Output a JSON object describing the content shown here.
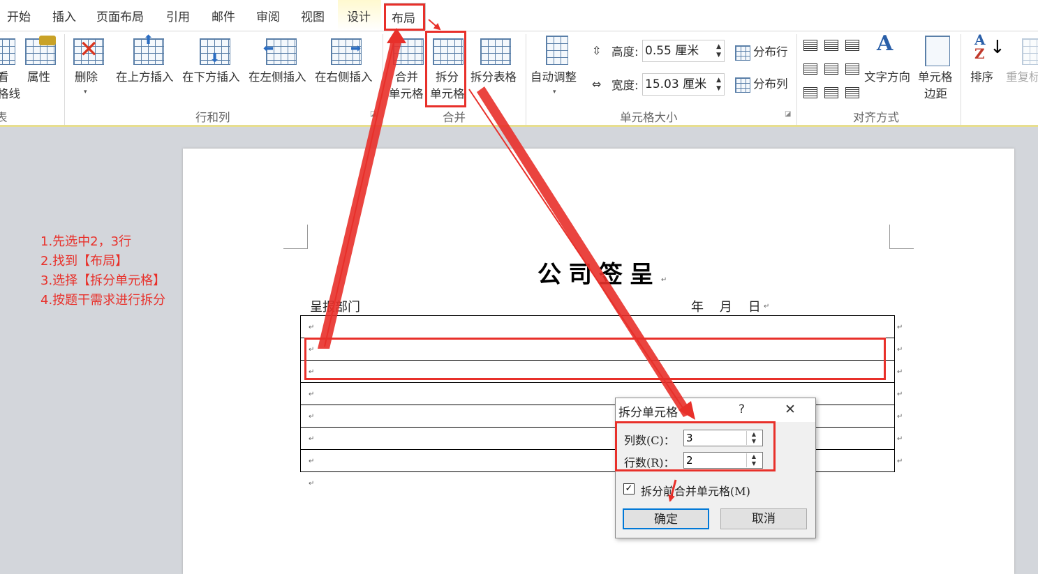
{
  "tabs": [
    "开始",
    "插入",
    "页面布局",
    "引用",
    "邮件",
    "审阅",
    "视图",
    "设计",
    "布局"
  ],
  "active_tab": "布局",
  "ribbon": {
    "table_group": {
      "view_gridlines": "看\n格线",
      "properties": "属性",
      "group_label_fragment": "表"
    },
    "rows_cols": {
      "delete": "删除",
      "insert_above": "在上方插入",
      "insert_below": "在下方插入",
      "insert_left": "在左侧插入",
      "insert_right": "在右侧插入",
      "group_label": "行和列"
    },
    "merge": {
      "merge_cells_1": "合并",
      "merge_cells_2": "单元格",
      "split_cells_1": "拆分",
      "split_cells_2": "单元格",
      "split_table": "拆分表格",
      "group_label": "合并"
    },
    "cell_size": {
      "autofit": "自动调整",
      "height_label": "高度:",
      "height_value": "0.55 厘米",
      "width_label": "宽度:",
      "width_value": "15.03 厘米",
      "distribute_rows": "分布行",
      "distribute_cols": "分布列",
      "group_label": "单元格大小"
    },
    "alignment": {
      "text_direction": "文字方向",
      "cell_margins_1": "单元格",
      "cell_margins_2": "边距",
      "group_label": "对齐方式"
    },
    "data": {
      "sort": "排序",
      "repeat_header": "重复标"
    }
  },
  "document": {
    "title": "公司签呈",
    "dept_label": "呈报部门",
    "date_label": "年    月    日",
    "table_rows": 7,
    "paragraph_mark": "↵"
  },
  "instructions": [
    "1.先选中2，3行",
    "2.找到【布局】",
    "3.选择【拆分单元格】",
    "4.按题干需求进行拆分"
  ],
  "dialog": {
    "title": "拆分单元格",
    "help": "?",
    "close": "✕",
    "cols_label": "列数(C)：",
    "cols_value": "3",
    "rows_label": "行数(R)：",
    "rows_value": "2",
    "merge_before_split": "拆分前合并单元格(M)",
    "merge_checked": true,
    "ok": "确定",
    "cancel": "取消"
  },
  "colors": {
    "annotation_red": "#e8302a",
    "ribbon_accent": "#e7de8f",
    "page_bg": "#d3d6db"
  }
}
